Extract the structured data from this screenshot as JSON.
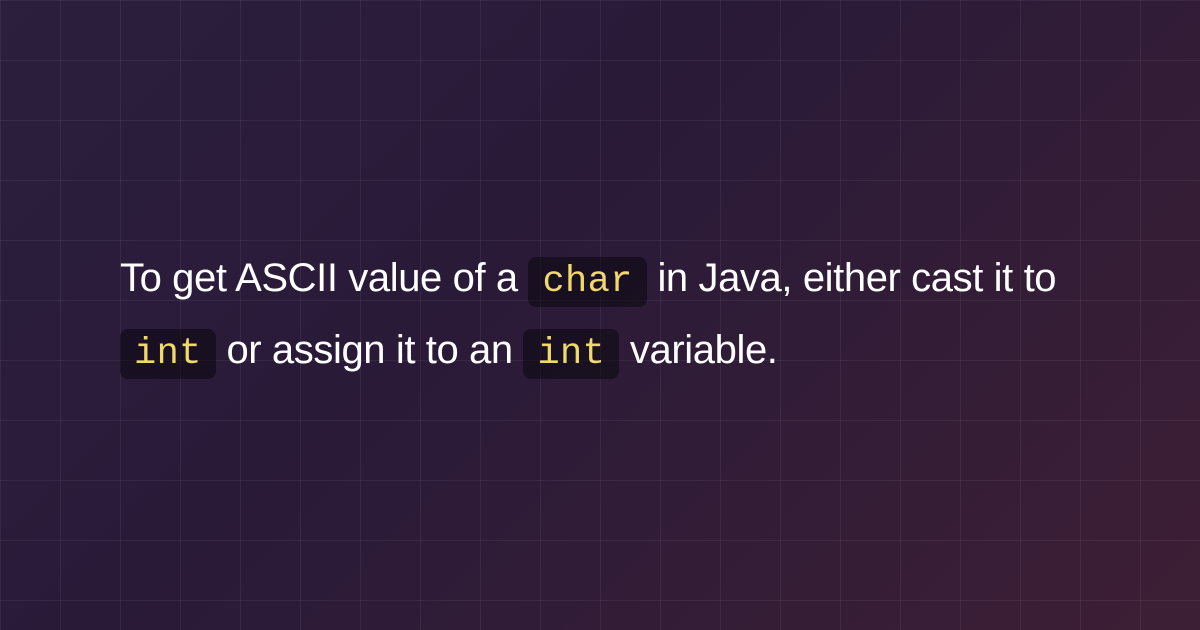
{
  "content": {
    "segments": {
      "s1": "To get ASCII value of a ",
      "code1": "char",
      "s2": " in Java, either cast it to ",
      "code2": "int",
      "s3": " or assign it to an ",
      "code3": "int",
      "s4": " variable."
    }
  }
}
